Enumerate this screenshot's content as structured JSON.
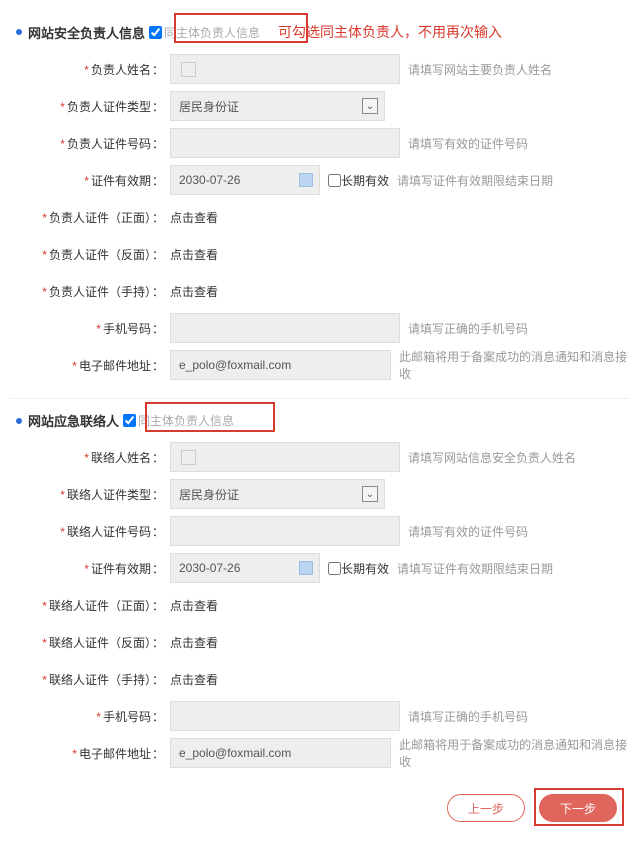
{
  "section1": {
    "title": "网站安全负责人信息",
    "checkbox_label": "同主体负责人信息",
    "hint": "可勾选同主体负责人，不用再次输入",
    "rows": {
      "name": {
        "label": "负责人姓名",
        "value": "",
        "hint": "请填写网站主要负责人姓名"
      },
      "id_type": {
        "label": "负责人证件类型",
        "value": "居民身份证"
      },
      "id_number": {
        "label": "负责人证件号码",
        "value": "",
        "hint": "请填写有效的证件号码"
      },
      "valid_date": {
        "label": "证件有效期",
        "value": "2030-07-26",
        "long_valid": "长期有效",
        "hint": "请填写证件有效期限结束日期"
      },
      "cert_front": {
        "label": "负责人证件（正面）",
        "link": "点击查看"
      },
      "cert_back": {
        "label": "负责人证件（反面）",
        "link": "点击查看"
      },
      "cert_hand": {
        "label": "负责人证件（手持）",
        "link": "点击查看"
      },
      "phone": {
        "label": "手机号码",
        "value": "",
        "hint": "请填写正确的手机号码"
      },
      "email": {
        "label": "电子邮件地址",
        "value": "e_polo@foxmail.com",
        "hint": "此邮箱将用于备案成功的消息通知和消息接收"
      }
    }
  },
  "section2": {
    "title": "网站应急联络人",
    "checkbox_label": "同主体负责人信息",
    "rows": {
      "name": {
        "label": "联络人姓名",
        "value": "",
        "hint": "请填写网站信息安全负责人姓名"
      },
      "id_type": {
        "label": "联络人证件类型",
        "value": "居民身份证"
      },
      "id_number": {
        "label": "联络人证件号码",
        "value": "",
        "hint": "请填写有效的证件号码"
      },
      "valid_date": {
        "label": "证件有效期",
        "value": "2030-07-26",
        "long_valid": "长期有效",
        "hint": "请填写证件有效期限结束日期"
      },
      "cert_front": {
        "label": "联络人证件（正面）",
        "link": "点击查看"
      },
      "cert_back": {
        "label": "联络人证件（反面）",
        "link": "点击查看"
      },
      "cert_hand": {
        "label": "联络人证件（手持）",
        "link": "点击查看"
      },
      "phone": {
        "label": "手机号码",
        "value": "",
        "hint": "请填写正确的手机号码"
      },
      "email": {
        "label": "电子邮件地址",
        "value": "e_polo@foxmail.com",
        "hint": "此邮箱将用于备案成功的消息通知和消息接收"
      }
    }
  },
  "buttons": {
    "prev": "上一步",
    "next": "下一步"
  }
}
